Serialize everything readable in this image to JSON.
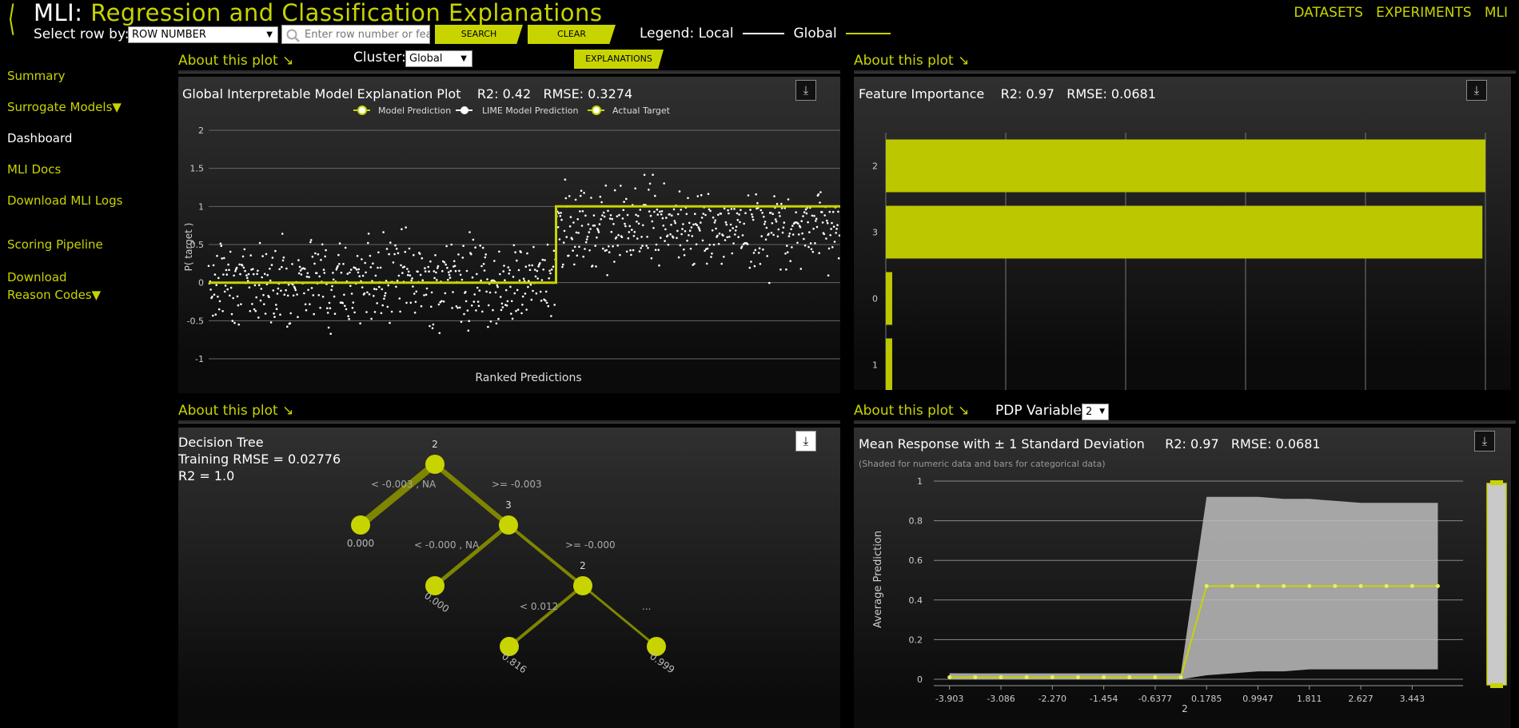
{
  "header": {
    "prefix": "MLI:",
    "title": "Regression and Classification Explanations",
    "select_row_label": "Select row by:",
    "select_row_value": "ROW NUMBER",
    "search_placeholder": "Enter row number or fea",
    "search_button": "SEARCH",
    "clear_button": "CLEAR",
    "legend_label": "Legend:",
    "legend_local": "Local",
    "legend_global": "Global",
    "nav": [
      "DATASETS",
      "EXPERIMENTS",
      "MLI"
    ]
  },
  "sidebar": {
    "items": [
      "Summary",
      "Surrogate Models▼",
      "Dashboard",
      "MLI Docs",
      "Download MLI Logs",
      "Scoring Pipeline",
      "Download Reason Codes▼"
    ]
  },
  "cluster": {
    "label": "Cluster:",
    "value": "Global",
    "explanations_button": "EXPLANATIONS"
  },
  "about_label": "About this plot ↘",
  "pdp": {
    "label": "PDP Variable:",
    "value": "2"
  },
  "global_plot": {
    "title": "Global Interpretable Model Explanation Plot",
    "r2": "R2: 0.42",
    "rmse": "RMSE: 0.3274",
    "legend": [
      "Model Prediction",
      "LIME Model Prediction",
      "Actual Target"
    ],
    "ylabel": "P( target )",
    "xlabel": "Ranked Predictions",
    "yticks": [
      "2",
      "1.5",
      "1",
      "0.5",
      "0",
      "-0.5",
      "-1"
    ]
  },
  "feature_importance": {
    "title": "Feature Importance",
    "r2": "R2: 0.97",
    "rmse": "RMSE: 0.0681",
    "features": [
      "2",
      "3",
      "0",
      "1"
    ]
  },
  "decision_tree": {
    "title": "Decision Tree",
    "training_rmse": "Training RMSE = 0.02776",
    "r2": "R2 = 1.0",
    "nodes": [
      "2",
      "3",
      "2"
    ],
    "edges": [
      "< -0.003 , NA",
      ">= -0.003",
      "< -0.000 , NA",
      ">= -0.000",
      "< 0.012",
      "..."
    ],
    "leaves": [
      "0.000",
      "0.000",
      "0.816",
      "0.999"
    ]
  },
  "mean_response": {
    "title": "Mean Response with ± 1 Standard Deviation",
    "r2": "R2: 0.97",
    "rmse": "RMSE: 0.0681",
    "subtitle": "(Shaded for numeric data and bars for categorical data)",
    "ylabel": "Average Prediction",
    "xlabel": "2",
    "yticks": [
      "1",
      "0.8",
      "0.6",
      "0.4",
      "0.2",
      "0"
    ],
    "xticks": [
      "-3.903",
      "-3.086",
      "-2.270",
      "-1.454",
      "-0.6377",
      "0.1785",
      "0.9947",
      "1.811",
      "2.627",
      "3.443"
    ]
  },
  "colors": {
    "accent": "#c8d400",
    "background": "#000000",
    "panel": "#1e1e1e"
  },
  "icons": [
    "back-chevron-icon",
    "search-icon",
    "download-icon"
  ],
  "chart_data": [
    {
      "type": "scatter",
      "title": "Global Interpretable Model Explanation Plot",
      "xlabel": "Ranked Predictions",
      "ylabel": "P( target )",
      "ylim": [
        -1,
        2
      ],
      "series": [
        {
          "name": "Model Prediction",
          "step": [
            [
              0,
              0
            ],
            [
              0.55,
              0
            ],
            [
              0.55,
              1
            ],
            [
              1,
              1
            ]
          ]
        },
        {
          "name": "Actual Target",
          "points": "scattered around 0 (rank<0.55) and around 0.7 (rank>0.55)"
        }
      ]
    },
    {
      "type": "bar",
      "title": "Feature Importance",
      "categories": [
        "2",
        "3",
        "0",
        "1"
      ],
      "values": [
        1.0,
        0.995,
        0.006,
        0.005
      ],
      "xlim": [
        0,
        1
      ]
    },
    {
      "type": "line",
      "title": "Mean Response with ± 1 Standard Deviation",
      "xlabel": "2",
      "ylabel": "Average Prediction",
      "ylim": [
        0,
        1
      ],
      "x": [
        -3.903,
        -3.494,
        -3.086,
        -2.678,
        -2.27,
        -1.862,
        -1.454,
        -1.046,
        -0.6377,
        -0.23,
        0.1785,
        0.5866,
        0.9947,
        1.403,
        1.811,
        2.219,
        2.627,
        3.035,
        3.443,
        3.851
      ],
      "series": [
        {
          "name": "mean",
          "values": [
            0.01,
            0.01,
            0.01,
            0.01,
            0.01,
            0.01,
            0.01,
            0.01,
            0.01,
            0.01,
            0.47,
            0.47,
            0.47,
            0.47,
            0.47,
            0.47,
            0.47,
            0.47,
            0.47,
            0.47
          ]
        },
        {
          "name": "upper",
          "values": [
            0.03,
            0.03,
            0.03,
            0.03,
            0.03,
            0.03,
            0.03,
            0.03,
            0.03,
            0.03,
            0.92,
            0.92,
            0.92,
            0.91,
            0.91,
            0.9,
            0.89,
            0.89,
            0.89,
            0.89
          ]
        },
        {
          "name": "lower",
          "values": [
            0.0,
            0.0,
            0.0,
            0.0,
            0.0,
            0.0,
            0.0,
            0.0,
            0.0,
            0.0,
            0.02,
            0.03,
            0.04,
            0.04,
            0.05,
            0.05,
            0.05,
            0.05,
            0.05,
            0.05
          ]
        }
      ]
    }
  ]
}
